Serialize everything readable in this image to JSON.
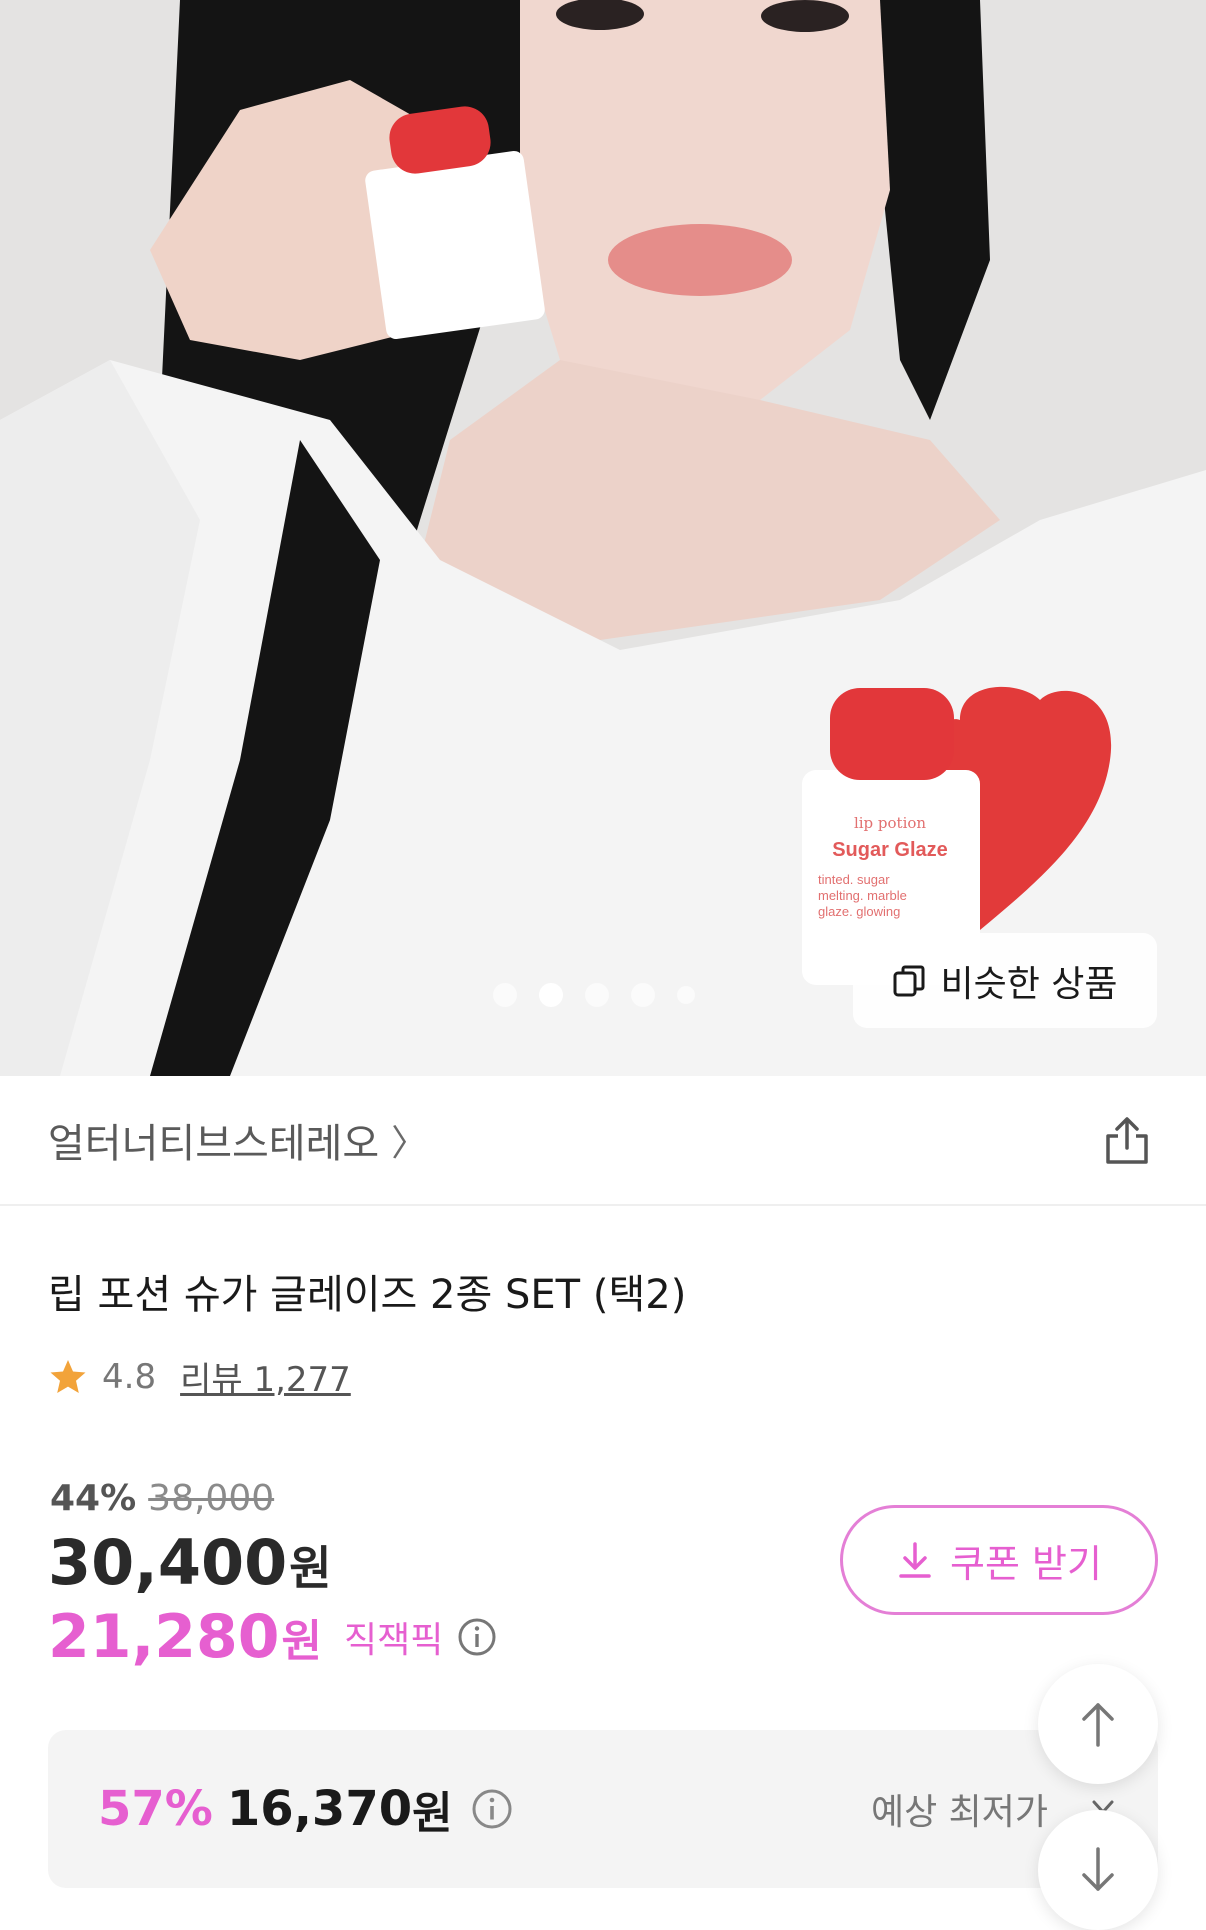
{
  "hero": {
    "slide_count": 5,
    "active_slide": 2,
    "similar_button_label": "비슷한 상품",
    "product_in_image": {
      "line1": "lip potion",
      "line2": "Sugar Glaze",
      "line3": "tinted. sugar",
      "line4": "melting. marble",
      "line5": "glaze. glowing"
    }
  },
  "brand": {
    "name": "얼터너티브스테레오",
    "chevron": "〉"
  },
  "product": {
    "title": "립 포션 슈가 글레이즈 2종 SET (택2)",
    "rating": "4.8",
    "review_text": "리뷰 1,277"
  },
  "pricing": {
    "discount_percent": "44%",
    "original_price": "38,000",
    "price": "30,400",
    "price_unit": "원",
    "pick_price": "21,280",
    "pick_unit": "원",
    "pick_label": "직잭픽",
    "coupon_button_label": "쿠폰 받기"
  },
  "lowest": {
    "percent": "57%",
    "price": "16,370",
    "unit": "원",
    "label": "예상 최저가"
  },
  "colors": {
    "accent_pink": "#e65fd0",
    "star": "#f2a33a",
    "box_bg": "#f4f4f4"
  }
}
